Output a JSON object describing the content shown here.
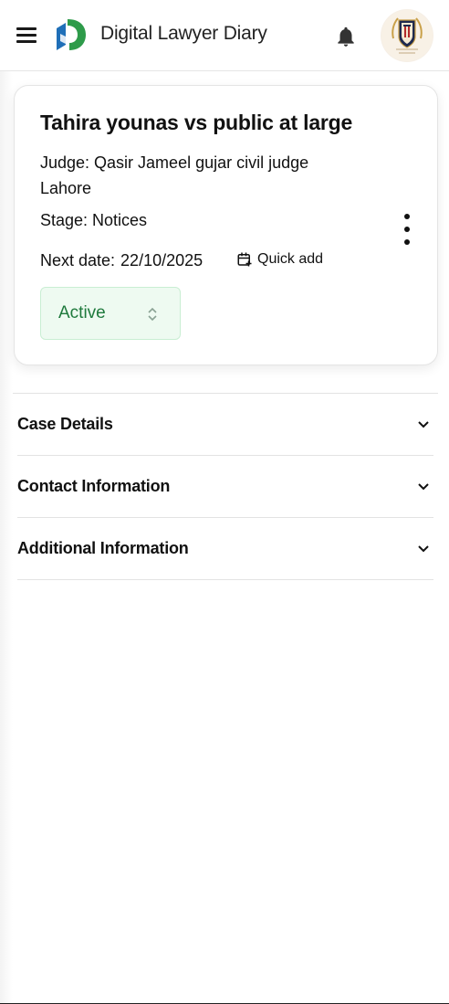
{
  "header": {
    "app_title": "Digital Lawyer Diary",
    "menu_icon": "hamburger-menu-icon",
    "bell_icon": "bell-icon",
    "logo_colors": {
      "blue": "#1f6fb8",
      "green": "#2e9b4a"
    }
  },
  "case": {
    "title": "Tahira younas vs public at large",
    "judge": "Judge: Qasir Jameel gujar civil judge Lahore",
    "stage": "Stage: Notices",
    "next_date_label": "Next date:",
    "next_date_value": "22/10/2025",
    "quick_add_label": "Quick add",
    "status": "Active",
    "status_color": "#1f7a3d"
  },
  "sections": [
    {
      "label": "Case Details"
    },
    {
      "label": "Contact Information"
    },
    {
      "label": "Additional Information"
    }
  ]
}
